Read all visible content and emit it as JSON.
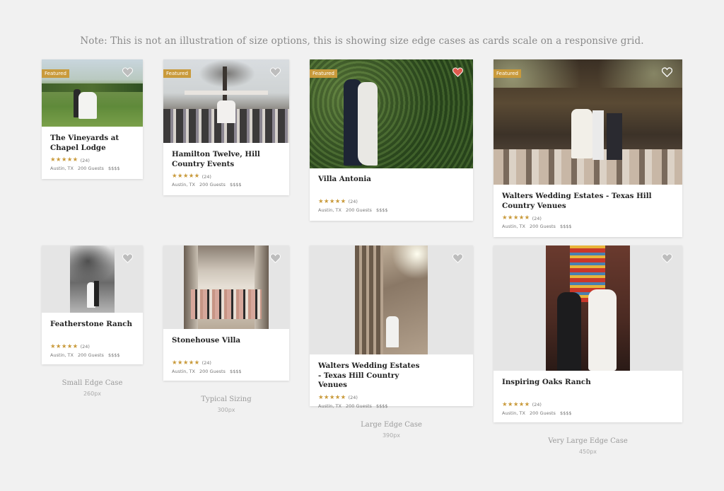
{
  "note": "Note: This is not an illustration of size options, this is showing size edge cases as cards scale on a responsive grid.",
  "featured_label": "Featured",
  "colors": {
    "accent": "#c99a3b",
    "heart_active": "#e05b4f",
    "heart_inactive": "#ffffff",
    "background": "#f1f1f1"
  },
  "top_row": [
    {
      "title": "The Vineyards at Chapel Lodge",
      "reviews": "(24)",
      "location": "Austin, TX",
      "guests": "200 Guests",
      "price": "$$$$",
      "featured": true,
      "favorited": false
    },
    {
      "title": "Hamilton Twelve, Hill Country Events",
      "reviews": "(24)",
      "location": "Austin, TX",
      "guests": "200 Guests",
      "price": "$$$$",
      "featured": true,
      "favorited": false
    },
    {
      "title": "Villa Antonia",
      "reviews": "(24)",
      "location": "Austin, TX",
      "guests": "200 Guests",
      "price": "$$$$",
      "featured": true,
      "favorited": true
    },
    {
      "title": "Walters Wedding Estates - Texas Hill Country Venues",
      "reviews": "(24)",
      "location": "Austin, TX",
      "guests": "200 Guests",
      "price": "$$$$",
      "featured": true,
      "favorited": false
    }
  ],
  "bottom_row": [
    {
      "title": "Featherstone Ranch",
      "reviews": "(24)",
      "location": "Austin, TX",
      "guests": "200 Guests",
      "price": "$$$$",
      "favorited": false
    },
    {
      "title": "Stonehouse Villa",
      "reviews": "(24)",
      "location": "Austin, TX",
      "guests": "200 Guests",
      "price": "$$$$",
      "favorited": false
    },
    {
      "title": "Walters Wedding Estates - Texas Hill Country Venues",
      "reviews": "(24)",
      "location": "Austin, TX",
      "guests": "200 Guests",
      "price": "$$$$",
      "favorited": false
    },
    {
      "title": "Inspiring Oaks Ranch",
      "reviews": "(24)",
      "location": "Austin, TX",
      "guests": "200 Guests",
      "price": "$$$$",
      "favorited": false
    }
  ],
  "columns": [
    {
      "label": "Small Edge Case",
      "size": "260px"
    },
    {
      "label": "Typical Sizing",
      "size": "300px"
    },
    {
      "label": "Large Edge Case",
      "size": "390px"
    },
    {
      "label": "Very Large Edge Case",
      "size": "450px"
    }
  ],
  "rating_stars": "★★★★★"
}
